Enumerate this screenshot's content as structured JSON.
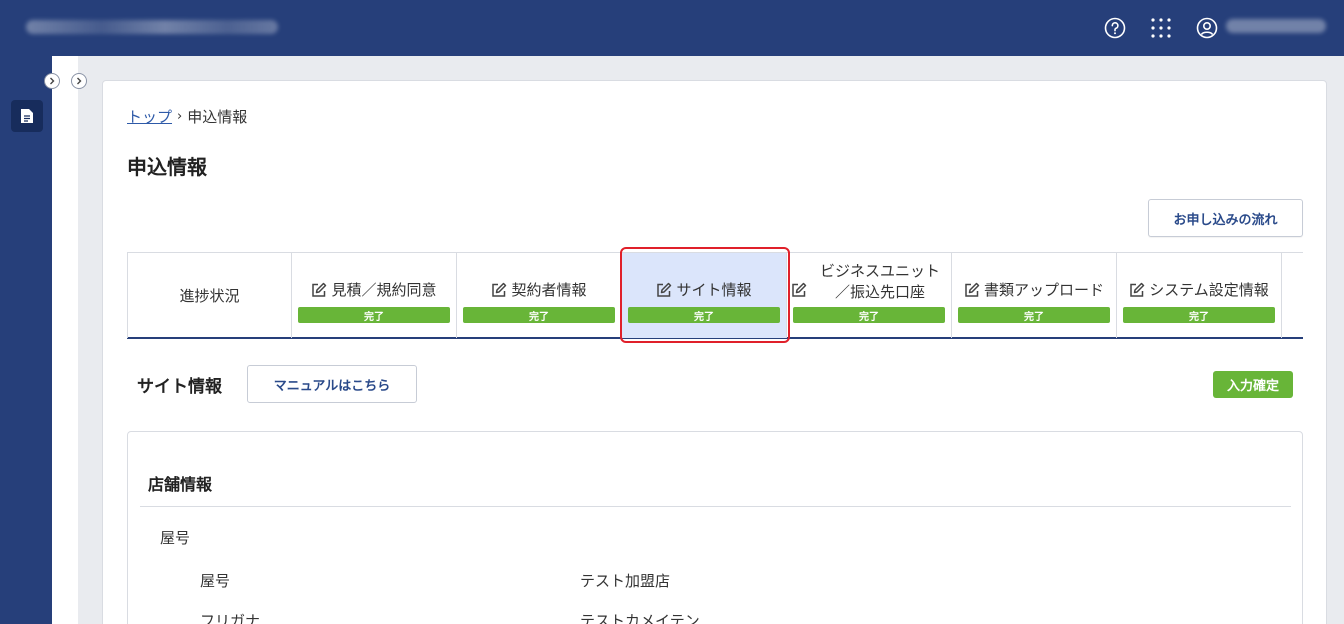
{
  "sidebar": {
    "doc_icon": "document-icon"
  },
  "breadcrumb": {
    "home": "トップ",
    "current": "申込情報"
  },
  "page": {
    "title": "申込情報",
    "flow_button": "お申し込みの流れ"
  },
  "steps": {
    "first": "進捗状況",
    "items": [
      {
        "label": "見積／規約同意",
        "status": "完了"
      },
      {
        "label": "契約者情報",
        "status": "完了"
      },
      {
        "label": "サイト情報",
        "status": "完了"
      },
      {
        "label1": "ビジネスユニット",
        "label2": "／振込先口座",
        "status": "完了"
      },
      {
        "label": "書類アップロード",
        "status": "完了"
      },
      {
        "label": "システム設定情報",
        "status": "完了"
      }
    ]
  },
  "section": {
    "title": "サイト情報",
    "manual_button": "マニュアルはこちら",
    "confirm_badge": "入力確定"
  },
  "panel": {
    "title": "店舗情報",
    "group": "屋号",
    "fields": [
      {
        "label": "屋号",
        "value": "テスト加盟店"
      },
      {
        "label": "フリガナ",
        "value": "テストカメイテン"
      }
    ]
  },
  "colors": {
    "brand_navy": "#263f7a",
    "done_green": "#68b538",
    "highlight_red": "#e0202a",
    "active_step_bg": "#dbe5fb"
  }
}
